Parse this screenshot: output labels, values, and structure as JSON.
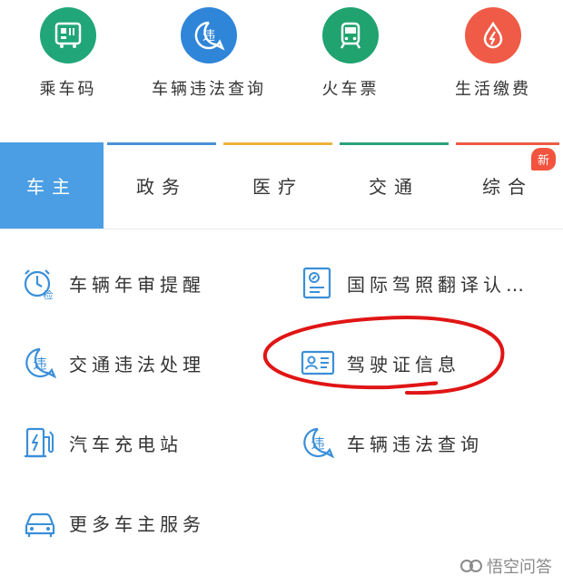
{
  "quick_actions": [
    {
      "label": "乘车码",
      "icon": "qr-bus-icon",
      "color": "#21a67a"
    },
    {
      "label": "车辆违法查询",
      "icon": "violation-icon",
      "color": "#2f85d8"
    },
    {
      "label": "火车票",
      "icon": "train-icon",
      "color": "#20a36f"
    },
    {
      "label": "生活缴费",
      "icon": "utility-drop-icon",
      "color": "#ef5b46"
    }
  ],
  "tabs": [
    {
      "label": "车主",
      "active": true
    },
    {
      "label": "政务",
      "bar_color": "#4a90d9"
    },
    {
      "label": "医疗",
      "bar_color": "#f0b23c"
    },
    {
      "label": "交通",
      "bar_color": "#2ba37a"
    },
    {
      "label": "综合",
      "bar_color": "#ef5a46",
      "badge": "新"
    }
  ],
  "services": [
    {
      "label": "车辆年审提醒",
      "icon": "annual-inspection-icon"
    },
    {
      "label": "国际驾照翻译认…",
      "icon": "license-translation-icon"
    },
    {
      "label": "交通违法处理",
      "icon": "violation-icon"
    },
    {
      "label": "驾驶证信息",
      "icon": "id-card-icon"
    },
    {
      "label": "汽车充电站",
      "icon": "charging-station-icon"
    },
    {
      "label": "车辆违法查询",
      "icon": "violation-icon"
    },
    {
      "label": "更多车主服务",
      "icon": "car-icon"
    }
  ],
  "watermark": {
    "text": "悟空问答",
    "icon": "wukong-icon"
  },
  "colors": {
    "accent": "#4b9ee4",
    "icon_blue": "#3a8fd9",
    "annotation_red": "#e01515"
  }
}
